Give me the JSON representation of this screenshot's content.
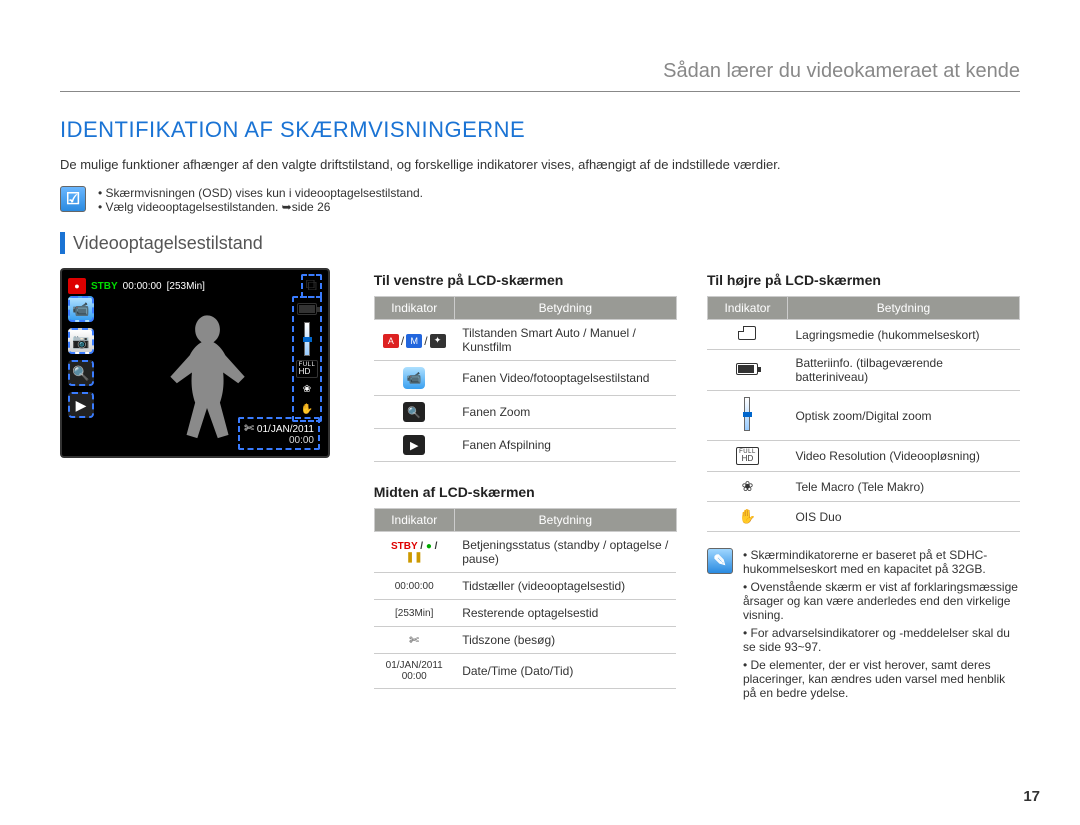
{
  "header": {
    "title": "Sådan lærer du videokameraet at kende"
  },
  "section": {
    "title": "IDENTIFIKATION AF SKÆRMVISNINGERNE"
  },
  "intro": "De mulige funktioner afhænger af den valgte driftstilstand, og forskellige indikatorer vises, afhængigt af de indstillede værdier.",
  "topNote": {
    "iconGlyph": "☑",
    "items": [
      "Skærmvisningen (OSD) vises kun i videooptagelsestilstand.",
      "Vælg videooptagelsestilstanden. ➥side 26"
    ]
  },
  "subtitle": "Videooptagelsestilstand",
  "lcd": {
    "stby": "STBY",
    "timer": "00:00:00",
    "remain": "[253Min]",
    "date": "01/JAN/2011",
    "clock": "00:00",
    "tzGlyph": "✄"
  },
  "leftTable": {
    "title": "Til venstre på LCD-skærmen",
    "th1": "Indikator",
    "th2": "Betydning",
    "rows": [
      {
        "meaning": "Tilstanden Smart Auto / Manuel / Kunstfilm"
      },
      {
        "meaning": "Fanen Video/fotooptagelsestilstand"
      },
      {
        "meaning": "Fanen Zoom"
      },
      {
        "meaning": "Fanen Afspilning"
      }
    ]
  },
  "midTable": {
    "title": "Midten af LCD-skærmen",
    "th1": "Indikator",
    "th2": "Betydning",
    "rows": [
      {
        "ind": "STBY / ● / ❚❚",
        "meaning": "Betjeningsstatus (standby / optagelse / pause)"
      },
      {
        "ind": "00:00:00",
        "meaning": "Tidstæller (videooptagelsestid)"
      },
      {
        "ind": "[253Min]",
        "meaning": "Resterende optagelsestid"
      },
      {
        "ind": "✄",
        "meaning": "Tidszone (besøg)"
      },
      {
        "ind": "01/JAN/2011 00:00",
        "meaning": "Date/Time (Dato/Tid)"
      }
    ]
  },
  "rightTable": {
    "title": "Til højre på LCD-skærmen",
    "th1": "Indikator",
    "th2": "Betydning",
    "rows": [
      {
        "meaning": "Lagringsmedie (hukommelseskort)"
      },
      {
        "meaning": "Batteriinfo. (tilbageværende batteriniveau)"
      },
      {
        "meaning": "Optisk zoom/Digital zoom"
      },
      {
        "meaning": "Video Resolution (Videoopløsning)"
      },
      {
        "meaning": "Tele Macro (Tele Makro)"
      },
      {
        "meaning": "OIS Duo"
      }
    ]
  },
  "rightNote": {
    "iconGlyph": "✎",
    "items": [
      "Skærmindikatorerne er baseret på et SDHC-hukommelseskort med en kapacitet på 32GB.",
      "Ovenstående skærm er vist af forklaringsmæssige årsager og kan være anderledes end den virkelige visning.",
      "For advarselsindikatorer og -meddelelser skal du se side 93~97.",
      "De elementer, der er vist herover, samt deres placeringer, kan ændres uden varsel med henblik på en bedre ydelse."
    ]
  },
  "pageNumber": "17"
}
